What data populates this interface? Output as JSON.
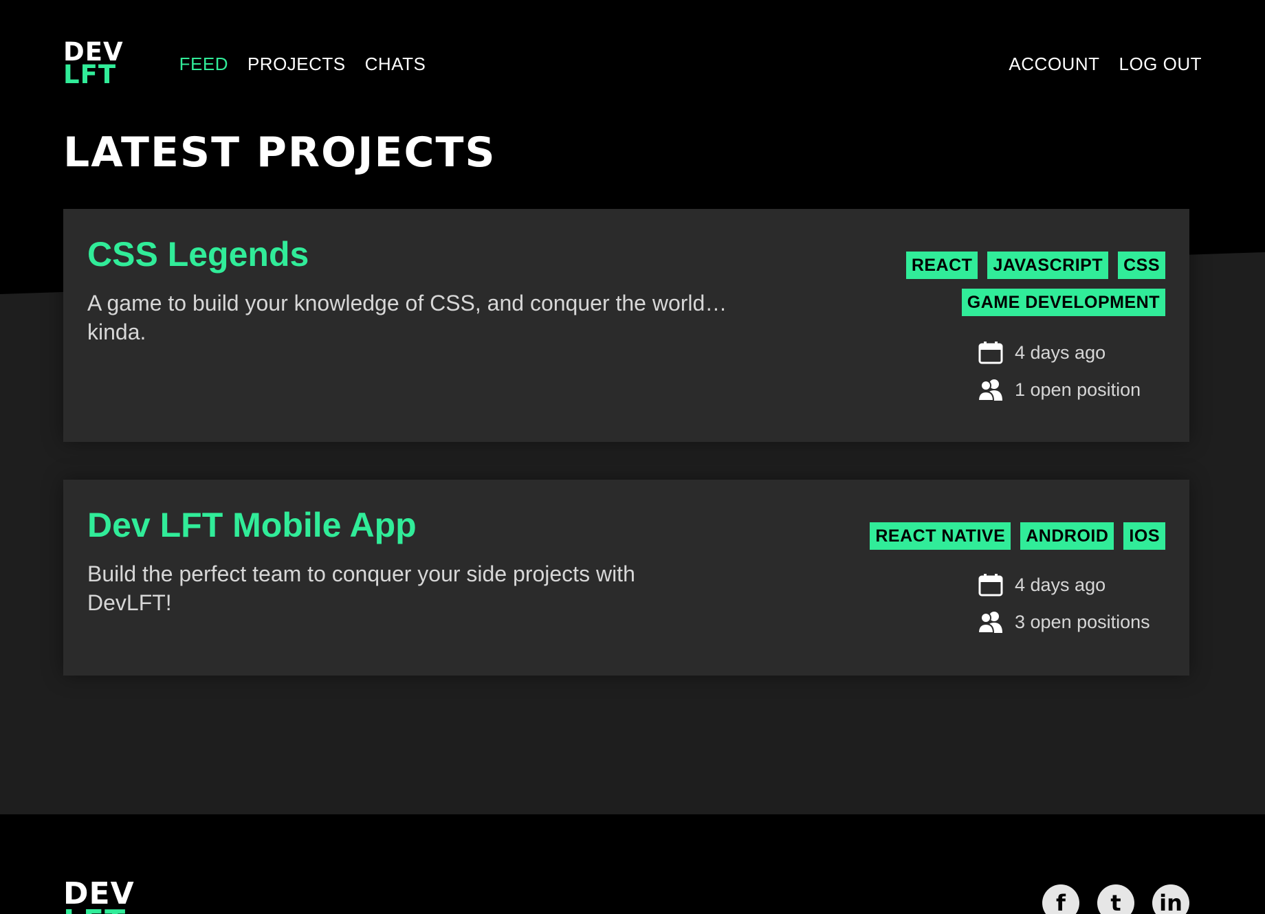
{
  "brand": {
    "logo_line1": "DEV",
    "logo_line2": "LFT",
    "accent_color": "#31ec99"
  },
  "nav": {
    "items": [
      {
        "label": "FEED",
        "active": true
      },
      {
        "label": "PROJECTS"
      },
      {
        "label": "CHATS"
      }
    ],
    "account_label": "ACCOUNT",
    "logout_label": "LOG OUT"
  },
  "page_title": "LATEST PROJECTS",
  "projects": [
    {
      "title": "CSS Legends",
      "description": "A game to build your knowledge of CSS, and conquer the world… kinda.",
      "tags": [
        "REACT",
        "JAVASCRIPT",
        "CSS",
        "GAME DEVELOPMENT"
      ],
      "posted": "4 days ago",
      "positions": "1 open position"
    },
    {
      "title": "Dev LFT Mobile App",
      "description": "Build the perfect team to conquer your side projects with DevLFT!",
      "tags": [
        "REACT NATIVE",
        "ANDROID",
        "IOS"
      ],
      "posted": "4 days ago",
      "positions": "3 open positions"
    }
  ],
  "meta_icons": {
    "date": "calendar-icon",
    "positions": "users-icon"
  },
  "footer": {
    "logo_line1": "DEV",
    "logo_line2": "LFT",
    "social": [
      {
        "icon": "facebook-icon",
        "glyph": "f"
      },
      {
        "icon": "twitter-icon",
        "glyph": "t"
      },
      {
        "icon": "linkedin-icon",
        "glyph": "in"
      }
    ]
  }
}
